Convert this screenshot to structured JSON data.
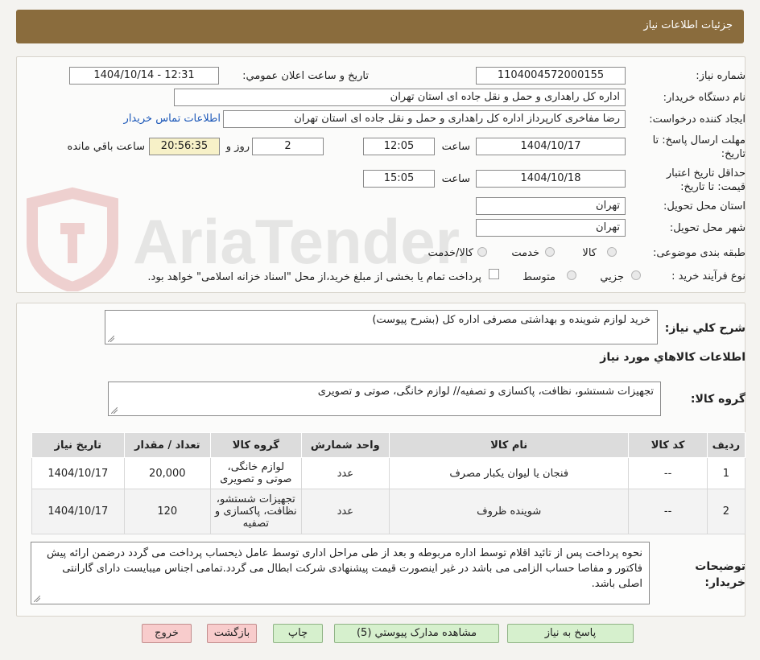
{
  "header": {
    "title": "جزئیات اطلاعات نیاز"
  },
  "watermark": {
    "text": "AriaTender.neT"
  },
  "form": {
    "need_number_label": "شماره نیاز:",
    "need_number": "1104004572000155",
    "announce_label": "تاریخ و ساعت اعلان عمومي:",
    "announce_value": "1404/10/14 - 12:31",
    "buyer_label": "نام دستگاه خریدار:",
    "buyer_value": "اداره کل راهداری و حمل و نقل جاده ای استان تهران",
    "requester_label": "ایجاد کننده درخواست:",
    "requester_value": "رضا مفاخری کارپرداز اداره کل راهداری و حمل و نقل جاده ای استان تهران",
    "contact_link": "اطلاعات تماس خریدار",
    "deadline_label": "مهلت ارسال پاسخ: تا تاریخ:",
    "deadline_date": "1404/10/17",
    "time_label": "ساعت",
    "deadline_time": "12:05",
    "days_value": "2",
    "days_label": "روز و",
    "remaining_time": "20:56:35",
    "remaining_label": "ساعت باقي مانده",
    "validity_label": "حداقل تاریخ اعتبار قیمت: تا تاریخ:",
    "validity_date": "1404/10/18",
    "validity_time": "15:05",
    "province_label": "استان محل تحویل:",
    "province_value": "تهران",
    "city_label": "شهر محل تحویل:",
    "city_value": "تهران",
    "category_label": "طبقه بندی موضوعی:",
    "category_options": [
      "کالا",
      "خدمت",
      "کالا/خدمت"
    ],
    "process_label": "نوع فرآیند خرید :",
    "process_options": [
      "جزیي",
      "متوسط"
    ],
    "payment_note": "پرداخت تمام یا بخشی از مبلغ خرید،از محل \"اسناد خزانه اسلامی\" خواهد بود."
  },
  "summary": {
    "label": "شرح کلي نیاز:",
    "value": "خرید لوازم شوینده و بهداشتی مصرفی اداره کل (بشرح پیوست)"
  },
  "goods": {
    "section_title": "اطلاعات کالاهاي مورد نیاز",
    "group_label": "گروه کالا:",
    "group_value": "تجهیزات شستشو، نظافت، پاکسازی و تصفیه// لوازم خانگی، صوتی و تصویری"
  },
  "table": {
    "headers": [
      "ردیف",
      "کد کالا",
      "نام کالا",
      "واحد شمارش",
      "گروه کالا",
      "تعداد / مقدار",
      "تاریخ نیاز"
    ],
    "rows": [
      [
        "1",
        "--",
        "فنجان یا لیوان یکبار مصرف",
        "عدد",
        "لوازم خانگی، صوتی و تصویری",
        "20,000",
        "1404/10/17"
      ],
      [
        "2",
        "--",
        "شوینده ظروف",
        "عدد",
        "تجهیزات شستشو، نظافت، پاکسازی و تصفیه",
        "120",
        "1404/10/17"
      ]
    ]
  },
  "notes": {
    "label": "توضیحات خریدار:",
    "value": "نحوه پرداخت پس از تائید اقلام توسط اداره مربوطه و بعد از طی مراحل اداری توسط عامل ذیحساب پرداخت می گردد درضمن ارائه پیش فاکتور و مفاصا حساب الزامی می باشد در غیر اینصورت قیمت پیشنهادی شرکت ابطال می گردد.تمامی اجناس میبایست دارای گارانتی اصلی باشد."
  },
  "buttons": {
    "reply": "پاسخ به نیاز",
    "attachments": "مشاهده مدارک پیوستي (5)",
    "print": "چاپ",
    "back": "بازگشت",
    "exit": "خروج"
  },
  "colors": {
    "header_bg": "#8a6c3d",
    "link": "#1b57b8",
    "time_bg": "#f7f1c8",
    "btn_green": "#d6f0cd",
    "btn_pink": "#f8cccc"
  }
}
